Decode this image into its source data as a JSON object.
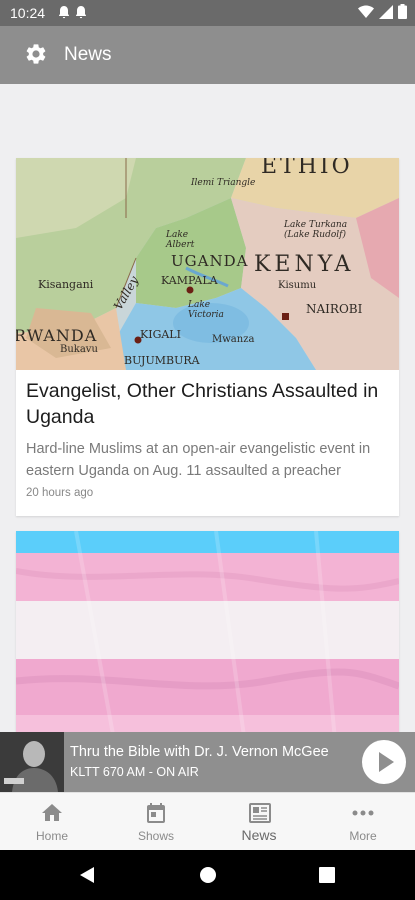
{
  "status_bar": {
    "time": "10:24"
  },
  "app_bar": {
    "title": "News",
    "settings_icon": "gear-icon"
  },
  "articles": [
    {
      "title": "Evangelist, Other Christians Assaulted in Uganda",
      "summary": "Hard-line Muslims at an open-air evangelistic event in eastern Uganda on Aug. 11 assaulted a preacher",
      "time": "20 hours ago",
      "image_labels": {
        "uganda": "UGANDA",
        "kenya": "KENYA",
        "rwanda": "RWANDA",
        "kampala": "KAMPALA",
        "kigali": "KIGALI",
        "nairobi": "NAIROBI",
        "bujumbura": "BUJUMBURA",
        "kisangani": "Kisangani",
        "lake_albert": "Lake Albert",
        "lake_turkana": "Lake Turkana (Lake Rudolf)",
        "lake_victoria": "Lake Victoria",
        "ilemi": "Ilemi Triangle",
        "mwanza": "Mwanza",
        "kisumu": "Kisumu",
        "bukavu": "Bukavu",
        "valley": "Valley",
        "ethio": "ETHIO"
      }
    },
    {
      "title": "",
      "image": "transgender-flag"
    }
  ],
  "now_playing": {
    "title": "Thru the Bible with Dr. J. Vernon McGee",
    "station": "KLTT 670 AM - ON AIR"
  },
  "bottom_nav": [
    {
      "label": "Home",
      "icon": "home-icon"
    },
    {
      "label": "Shows",
      "icon": "calendar-icon"
    },
    {
      "label": "News",
      "icon": "newspaper-icon",
      "active": true
    },
    {
      "label": "More",
      "icon": "more-icon"
    }
  ],
  "colors": {
    "status_bar": "#6a6a6a",
    "app_bar": "#8e8e8e",
    "now_playing": "#8f8f8f",
    "flag_blue": "#5bcefa",
    "flag_pink": "#f5a9b8"
  }
}
